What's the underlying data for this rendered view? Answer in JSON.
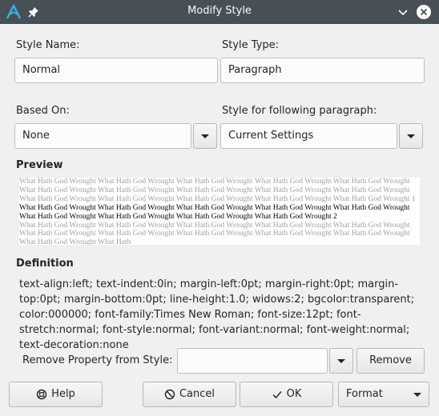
{
  "window": {
    "title": "Modify Style"
  },
  "style_name": {
    "label": "Style Name:",
    "value": "Normal"
  },
  "style_type": {
    "label": "Style Type:",
    "value": "Paragraph"
  },
  "based_on": {
    "label": "Based On:",
    "value": "None"
  },
  "following_style": {
    "label": "Style for following paragraph:",
    "value": "Current Settings"
  },
  "preview": {
    "heading": "Preview",
    "previous_paragraph": "What Hath God Wrought What Hath God Wrought What Hath God Wrought What Hath God Wrought What Hath God Wrought What Hath God Wrought What Hath God Wrought What Hath God Wrought What Hath God Wrought What Hath God Wrought What Hath God Wrought What Hath God Wrought What Hath God Wrought What Hath God Wrought What Hath God Wrought 1",
    "current_paragraph": "What Hath God Wrought What Hath God Wrought What Hath God Wrought What Hath God Wrought What Hath God Wrought What Hath God Wrought What Hath God Wrought What Hath God Wrought What Hath God Wrought 2",
    "following_paragraph": "What Hath God Wrought What Hath God Wrought What Hath God Wrought What Hath God Wrought What Hath God Wrought What Hath God Wrought What Hath God Wrought What Hath God Wrought What Hath God Wrought What Hath God Wrought What Hath God Wrought What Hath"
  },
  "definition": {
    "heading": "Definition",
    "text": "text-align:left; text-indent:0in; margin-left:0pt; margin-right:0pt; margin-top:0pt; margin-bottom:0pt; line-height:1.0; widows:2; bgcolor:transparent; color:000000; font-family:Times New Roman; font-size:12pt; font-stretch:normal; font-style:normal; font-variant:normal; font-weight:normal; text-decoration:none"
  },
  "remove_property": {
    "label": "Remove Property from Style:",
    "value": "",
    "remove_button": "Remove"
  },
  "buttons": {
    "help": "Help",
    "cancel": "Cancel",
    "ok": "OK",
    "format": "Format"
  },
  "colors": {
    "titlebar": "#475057",
    "accent": "#3daee9",
    "window_bg": "#eff0f1"
  },
  "icons": {
    "app": "abiword-icon",
    "pin": "pin-icon",
    "minimize": "minimize-icon",
    "close": "close-icon",
    "help": "lifebuoy-icon",
    "cancel": "cancel-icon",
    "ok": "check-icon"
  }
}
